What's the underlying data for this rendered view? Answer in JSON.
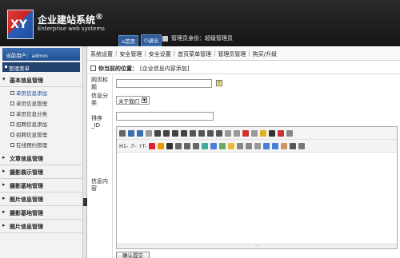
{
  "header": {
    "logo_text": "XY",
    "title": "企业建站系统",
    "title_mark": "®",
    "subtitle": "Enterprise web systems",
    "home_btn": "首页",
    "logout_btn": "退出",
    "user_label": "管理员身份：超级管理员"
  },
  "sidebar": {
    "user_box": "当前用户：admin",
    "menu_title": "管理菜单",
    "sections": [
      {
        "label": "基本信息管理",
        "open": true,
        "items": [
          "单页信息添加",
          "单页信息管理",
          "单页信息分类",
          "招聘信息添加",
          "招聘信息管理",
          "在线预约管理"
        ]
      },
      {
        "label": "文章信息管理"
      },
      {
        "label": "摄影展示管理"
      },
      {
        "label": "摄影基地管理"
      },
      {
        "label": "图片信息管理"
      },
      {
        "label": "摄影基地管理"
      },
      {
        "label": "图片信息管理"
      }
    ]
  },
  "topnav": [
    "系统设置",
    "安全管理",
    "安全设置",
    "首页菜单管理",
    "管理员管理",
    "购买/升级"
  ],
  "breadcrumb": {
    "prefix": "你当前的位置：",
    "path": "[企业信息内容添加]"
  },
  "form": {
    "title_label": "网页标题",
    "category_label": "信息分类",
    "category_value": "关于我们",
    "sort_label": "排序_ID",
    "content_label": "信息内容",
    "help_glyph": "?",
    "submit": "确认提交"
  },
  "editor": {
    "tb2_h1": "H1-",
    "tb2_font": "ℱ-",
    "tb2_size": "ᴛT-"
  }
}
